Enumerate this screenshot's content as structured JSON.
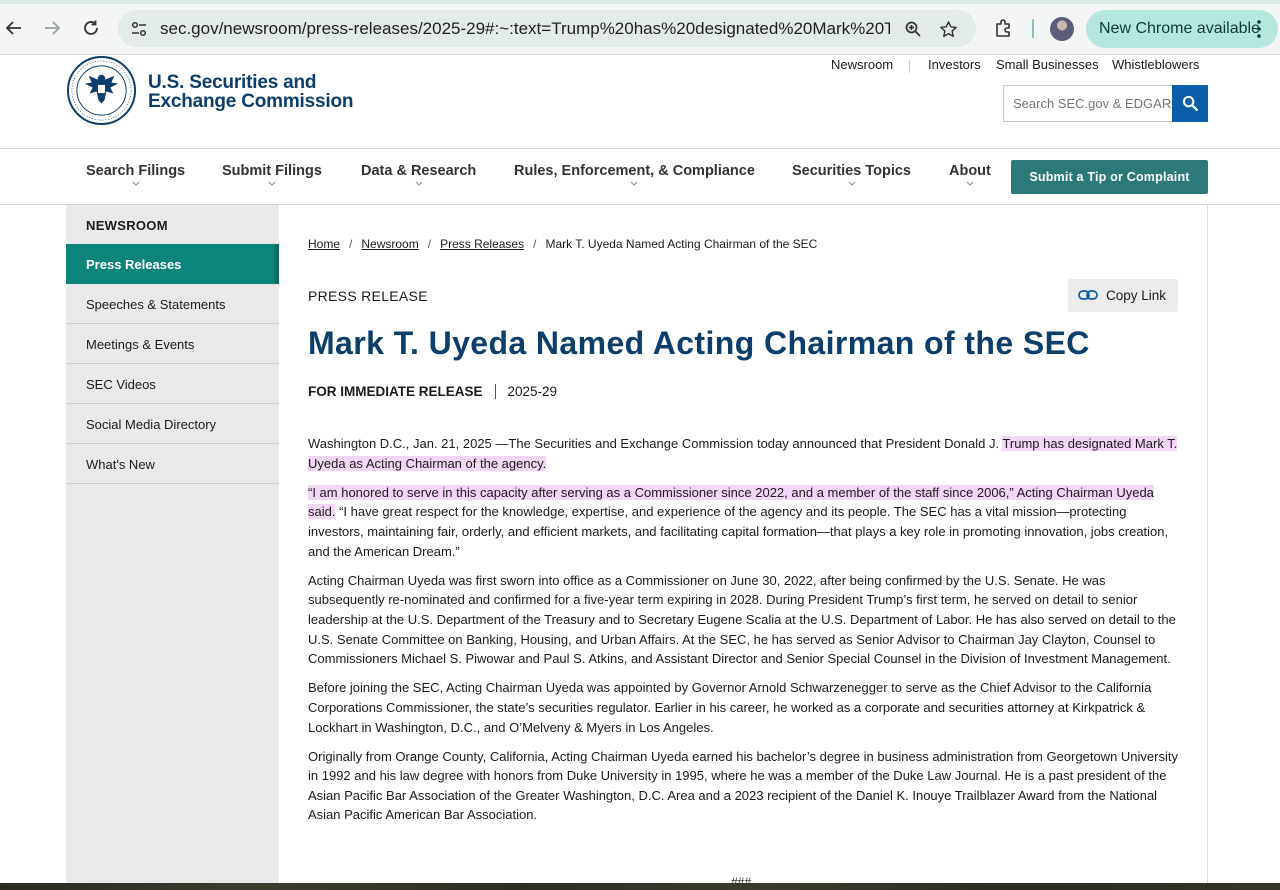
{
  "browser": {
    "url": "sec.gov/newsroom/press-releases/2025-29#:~:text=Trump%20has%20designated%20Mark%20T,...",
    "update_label": "New Chrome available"
  },
  "header": {
    "brand_line1": "U.S. Securities and",
    "brand_line2": "Exchange Commission",
    "util_links": [
      "Newsroom",
      "Investors",
      "Small Businesses",
      "Whistleblowers"
    ],
    "search_placeholder": "Search SEC.gov & EDGAR"
  },
  "nav": {
    "items": [
      "Search Filings",
      "Submit Filings",
      "Data & Research",
      "Rules, Enforcement, & Compliance",
      "Securities Topics",
      "About"
    ],
    "tip_button": "Submit a Tip or Complaint"
  },
  "sidebar": {
    "title": "NEWSROOM",
    "items": [
      "Press Releases",
      "Speeches & Statements",
      "Meetings & Events",
      "SEC Videos",
      "Social Media Directory",
      "What's New"
    ],
    "active_index": 0
  },
  "breadcrumb": [
    "Home",
    "Newsroom",
    "Press Releases",
    "Mark T. Uyeda Named Acting Chairman of the SEC"
  ],
  "article": {
    "eyebrow": "PRESS RELEASE",
    "copy_link": "Copy Link",
    "title": "Mark T. Uyeda Named Acting Chairman of the SEC",
    "release_label": "FOR IMMEDIATE RELEASE",
    "release_number": "2025-29",
    "p1_plain": "Washington D.C., Jan. 21, 2025 —The Securities and Exchange Commission today announced that President Donald J. ",
    "p1_highlight": "Trump has designated Mark T. Uyeda as Acting Chairman of the agency.",
    "p2_highlight": "“I am honored to serve in this capacity after serving as a Commissioner since 2022, and a member of the staff since 2006,” Acting Chairman Uyeda said.",
    "p2_plain": " “I have great respect for the knowledge, expertise, and experience of the agency and its people. The SEC has a vital mission—protecting investors, maintaining fair, orderly, and efficient markets, and facilitating capital formation—that plays a key role in promoting innovation, jobs creation, and the American Dream.”",
    "p3": "Acting Chairman Uyeda was first sworn into office as a Commissioner on June 30, 2022, after being confirmed by the U.S. Senate. He was subsequently re-nominated and confirmed for a five-year term expiring in 2028. During President Trump’s first term, he served on detail to senior leadership at the U.S. Department of the Treasury and to Secretary Eugene Scalia at the U.S. Department of Labor. He has also served on detail to the U.S. Senate Committee on Banking, Housing, and Urban Affairs. At the SEC, he has served as Senior Advisor to Chairman Jay Clayton, Counsel to Commissioners Michael S. Piwowar and Paul S. Atkins, and Assistant Director and Senior Special Counsel in the Division of Investment Management.",
    "p4": "Before joining the SEC, Acting Chairman Uyeda was appointed by Governor Arnold Schwarzenegger to serve as the Chief Advisor to the California Corporations Commissioner, the state’s securities regulator. Earlier in his career, he worked as a corporate and securities attorney at Kirkpatrick & Lockhart in Washington, D.C., and O’Melveny & Myers in Los Angeles.",
    "p5": "Originally from Orange County, California, Acting Chairman Uyeda earned his bachelor’s degree in business administration from Georgetown University in 1992 and his law degree with honors from Duke University in 1995, where he was a member of the Duke Law Journal. He is a past president of the Asian Pacific Bar Association of the Greater Washington, D.C. Area and a 2023 recipient of the Daniel K. Inouye Trailblazer Award from the National Asian Pacific American Bar Association.",
    "end_mark": "###"
  },
  "colors": {
    "brand_navy": "#0c3e6b",
    "teal_active": "#0e857a",
    "teal_button": "#2b7a78",
    "search_blue": "#0b5ea9",
    "highlight": "#f2d6f5"
  }
}
